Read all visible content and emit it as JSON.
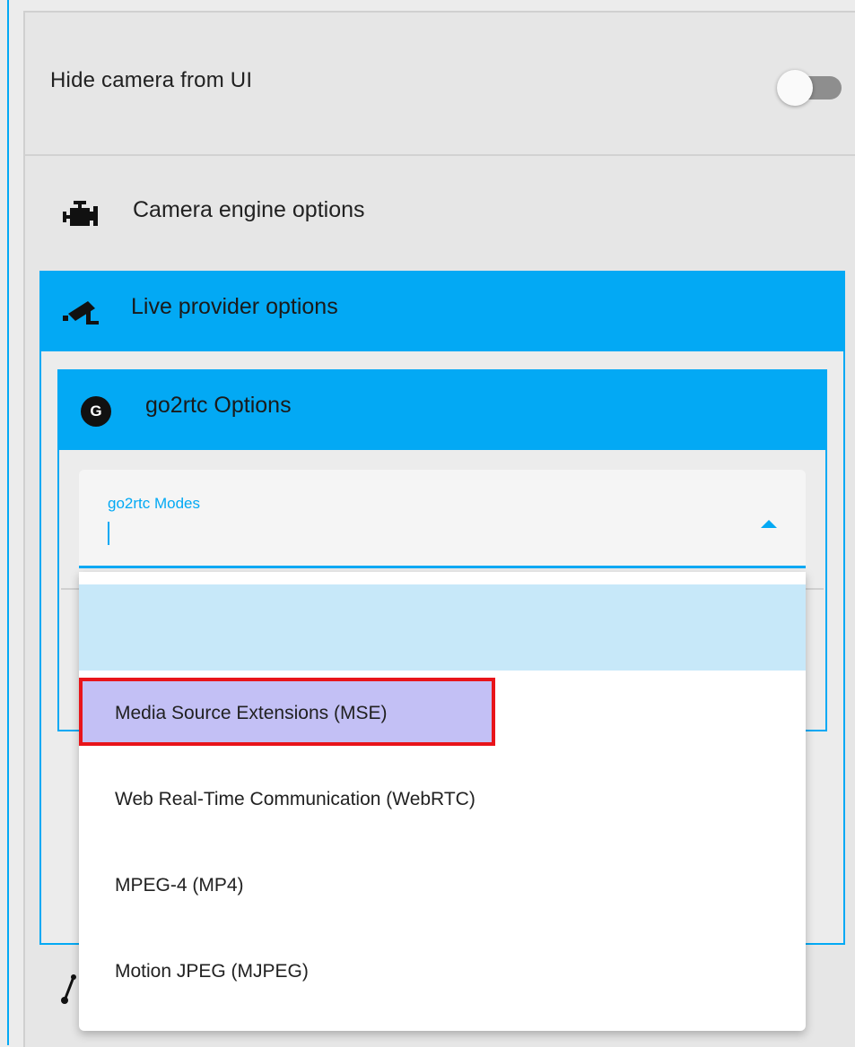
{
  "hide_camera": {
    "label": "Hide camera from UI",
    "toggle_on": false
  },
  "sections": {
    "camera_engine": {
      "label": "Camera engine options",
      "icon": "engine-icon"
    },
    "live_provider": {
      "label": "Live provider options",
      "icon": "cctv-camera-icon",
      "accent": "#03a9f4"
    },
    "go2rtc": {
      "label": "go2rtc Options",
      "icon_letter": "G"
    }
  },
  "go2rtc_modes": {
    "label": "go2rtc Modes",
    "value": "",
    "options": [
      "",
      "Media Source Extensions (MSE)",
      "Web Real-Time Communication (WebRTC)",
      "MPEG-4 (MP4)",
      "Motion JPEG (MJPEG)"
    ]
  }
}
